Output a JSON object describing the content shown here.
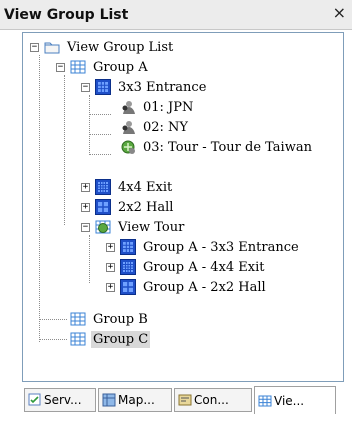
{
  "window": {
    "title": "View Group List",
    "close_glyph": "×"
  },
  "tree": {
    "root": {
      "label": "View Group List",
      "icon": "folder-icon"
    },
    "group_a": {
      "label": "Group A",
      "icon": "group-grid-icon"
    },
    "layout_3x3": {
      "label": "3x3 Entrance",
      "icon": "layout-3x3-icon"
    },
    "cam_jpn": {
      "label": "01: JPN",
      "icon": "camera-icon"
    },
    "cam_ny": {
      "label": "02: NY",
      "icon": "camera-icon"
    },
    "tour_taiwan": {
      "label": "03: Tour - Tour de Taiwan",
      "icon": "tour-icon"
    },
    "layout_4x4": {
      "label": "4x4 Exit",
      "icon": "layout-4x4-icon"
    },
    "layout_2x2": {
      "label": "2x2 Hall",
      "icon": "layout-2x2-icon"
    },
    "view_tour": {
      "label": "View Tour",
      "icon": "view-tour-icon"
    },
    "tour_3x3": {
      "label": "Group A - 3x3 Entrance",
      "icon": "layout-3x3-icon"
    },
    "tour_4x4": {
      "label": "Group A - 4x4 Exit",
      "icon": "layout-4x4-icon"
    },
    "tour_2x2": {
      "label": "Group A - 2x2 Hall",
      "icon": "layout-2x2-icon"
    },
    "group_b": {
      "label": "Group B",
      "icon": "group-grid-icon"
    },
    "group_c": {
      "label": "Group C",
      "icon": "group-grid-icon"
    },
    "expand_minus": "−",
    "expand_plus": "+"
  },
  "tabs": [
    {
      "label": "Serv...",
      "icon": "server-icon",
      "active": false
    },
    {
      "label": "Map...",
      "icon": "map-icon",
      "active": false
    },
    {
      "label": "Con...",
      "icon": "console-icon",
      "active": false
    },
    {
      "label": "Vie...",
      "icon": "view-icon",
      "active": true
    }
  ],
  "colors": {
    "selection": "#d8d8d8",
    "tree_border": "#7f9db9",
    "icon_blue": "#1f4fc8"
  }
}
